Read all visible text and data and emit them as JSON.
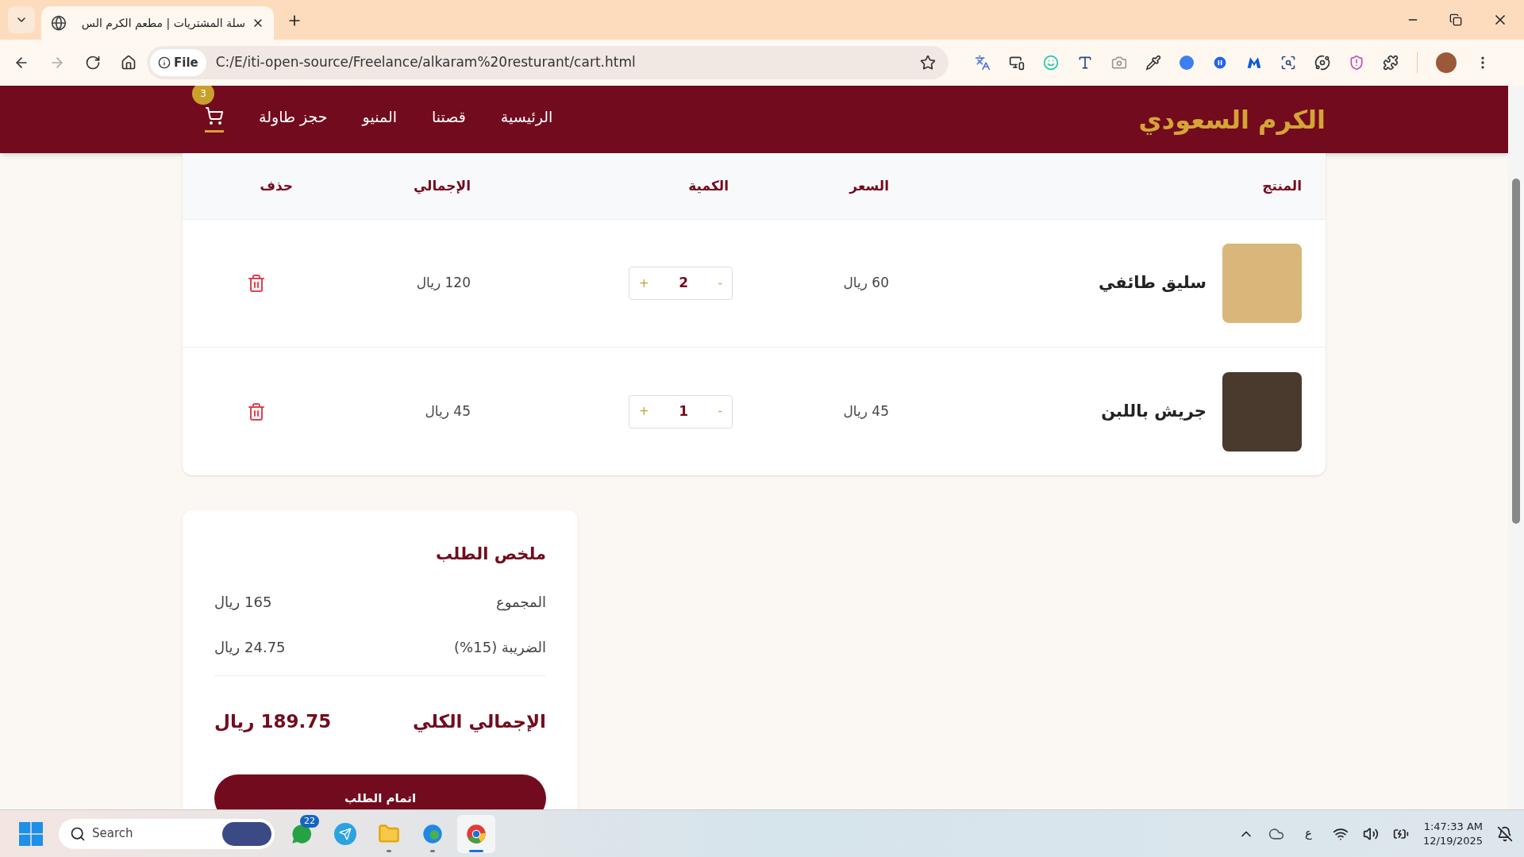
{
  "browser": {
    "tabs": [
      {
        "title": "سلة المشتريات | مطعم الكرم الس",
        "selected": true
      }
    ],
    "address": {
      "badge": "File",
      "url": "C:/E/iti-open-source/Freelance/alkaram%20resturant/cart.html"
    }
  },
  "navbar": {
    "logo": "الكرم السعودي",
    "links": [
      {
        "label": "الرئيسية",
        "selected": false
      },
      {
        "label": "قصتنا",
        "selected": false
      },
      {
        "label": "المنيو",
        "selected": false
      },
      {
        "label": "حجز طاولة",
        "selected": false
      }
    ],
    "cart": {
      "count": "3",
      "selected": true
    }
  },
  "cart_table": {
    "columns": [
      "المنتج",
      "السعر",
      "الكمية",
      "الإجمالي",
      "حذف"
    ],
    "rows": [
      {
        "name": "سليق طائفي",
        "price": "60 ريال",
        "decrement": "-",
        "quantity": "2",
        "increment": "+",
        "total": "120 ريال"
      },
      {
        "name": "جريش باللبن",
        "price": "45 ريال",
        "decrement": "-",
        "quantity": "1",
        "increment": "+",
        "total": "45 ريال"
      }
    ]
  },
  "summary": {
    "title": "ملخص الطلب",
    "lines": [
      {
        "label": "المجموع",
        "value": "165 ريال"
      },
      {
        "label": "الضريبة (15%)",
        "value": "24.75 ريال"
      }
    ],
    "total": {
      "label": "الإجمالي الكلي",
      "value": "189.75 ريال"
    },
    "button": "اتمام الطلب"
  },
  "taskbar": {
    "search_placeholder": "Search",
    "apps": [
      {
        "kind": "whatsapp",
        "badge": "22",
        "running": false,
        "active": false
      },
      {
        "kind": "telegram",
        "running": false,
        "active": false
      },
      {
        "kind": "files",
        "running": true,
        "active": false
      },
      {
        "kind": "edge",
        "running": true,
        "active": false
      },
      {
        "kind": "chrome",
        "running": true,
        "active": true
      }
    ],
    "language": "ع",
    "time": "1:47:33 AM",
    "date": "12/19/2025"
  }
}
